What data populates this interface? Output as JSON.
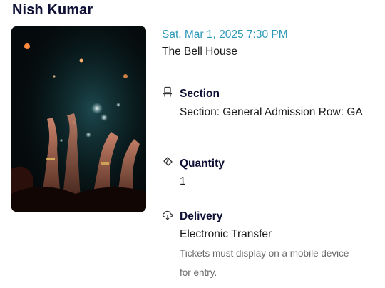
{
  "event": {
    "title": "Nish Kumar",
    "date": "Sat. Mar 1, 2025 7:30 PM",
    "venue": "The Bell House"
  },
  "section": {
    "icon": "seat-icon",
    "heading": "Section",
    "value": "Section: General Admission Row: GA"
  },
  "quantity": {
    "icon": "ticket-icon",
    "heading": "Quantity",
    "value": "1"
  },
  "delivery": {
    "icon": "delivery-icon",
    "heading": "Delivery",
    "value": "Electronic Transfer",
    "note": "Tickets must display on a mobile device for entry."
  },
  "colors": {
    "title": "#0f1035",
    "date_accent": "#2b98b7",
    "note_text": "#6a6a6a"
  }
}
